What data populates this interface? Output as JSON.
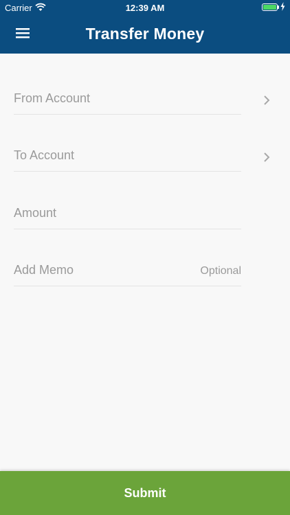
{
  "status_bar": {
    "carrier": "Carrier",
    "time": "12:39 AM",
    "icons": [
      "wifi-icon",
      "battery-icon",
      "charging-bolt-icon"
    ]
  },
  "header": {
    "title": "Transfer Money",
    "menu_icon": "hamburger-menu-icon",
    "background": "#0b4d80"
  },
  "form": {
    "from_account": {
      "label": "From Account",
      "icon": "chevron-right-icon"
    },
    "to_account": {
      "label": "To Account",
      "icon": "chevron-right-icon"
    },
    "amount": {
      "label": "Amount"
    },
    "memo": {
      "label": "Add Memo",
      "hint": "Optional"
    }
  },
  "submit": {
    "label": "Submit",
    "color": "#6ba43a"
  }
}
